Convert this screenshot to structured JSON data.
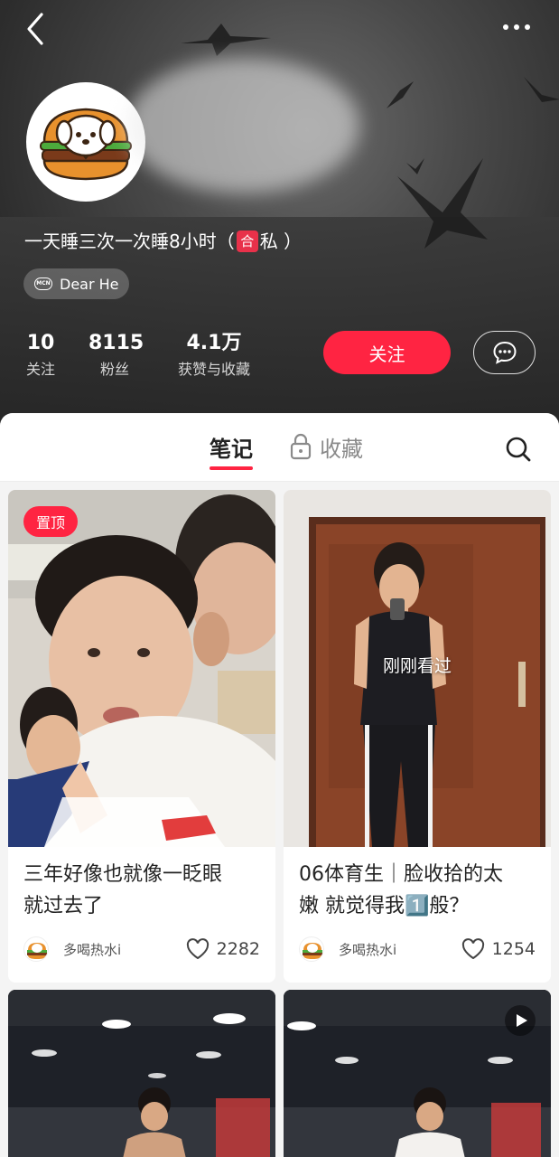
{
  "header": {
    "bio": "一天睡三次一次睡8小时（",
    "bio_emoji": "合",
    "bio_end": "私 ）",
    "mcn_icon_text": "MCN",
    "mcn_label": "Dear He",
    "stats": [
      {
        "num": "10",
        "label": "关注"
      },
      {
        "num": "8115",
        "label": "粉丝"
      },
      {
        "num": "4.1万",
        "label": "获赞与收藏"
      }
    ],
    "follow_label": "关注"
  },
  "tabs": {
    "notes": "笔记",
    "favorites": "收藏"
  },
  "cards": [
    {
      "pin": "置顶",
      "overlay": "",
      "title_line1": "三年好像也就像一眨眼",
      "title_line2": "就过去了",
      "author": "多喝热水i",
      "likes": "2282"
    },
    {
      "pin": "",
      "overlay": "刚刚看过",
      "title_line1": "06体育生｜脸收拾的太",
      "title_line2": "嫩 就觉得我1️⃣般？",
      "author": "多喝热水i",
      "likes": "1254"
    }
  ],
  "colors": {
    "accent": "#ff2442",
    "header_bg": "#2c2c2c"
  },
  "icons": [
    "back-icon",
    "more-icon",
    "chat-bubble-icon",
    "lock-icon",
    "search-icon",
    "heart-icon",
    "video-play-icon"
  ]
}
